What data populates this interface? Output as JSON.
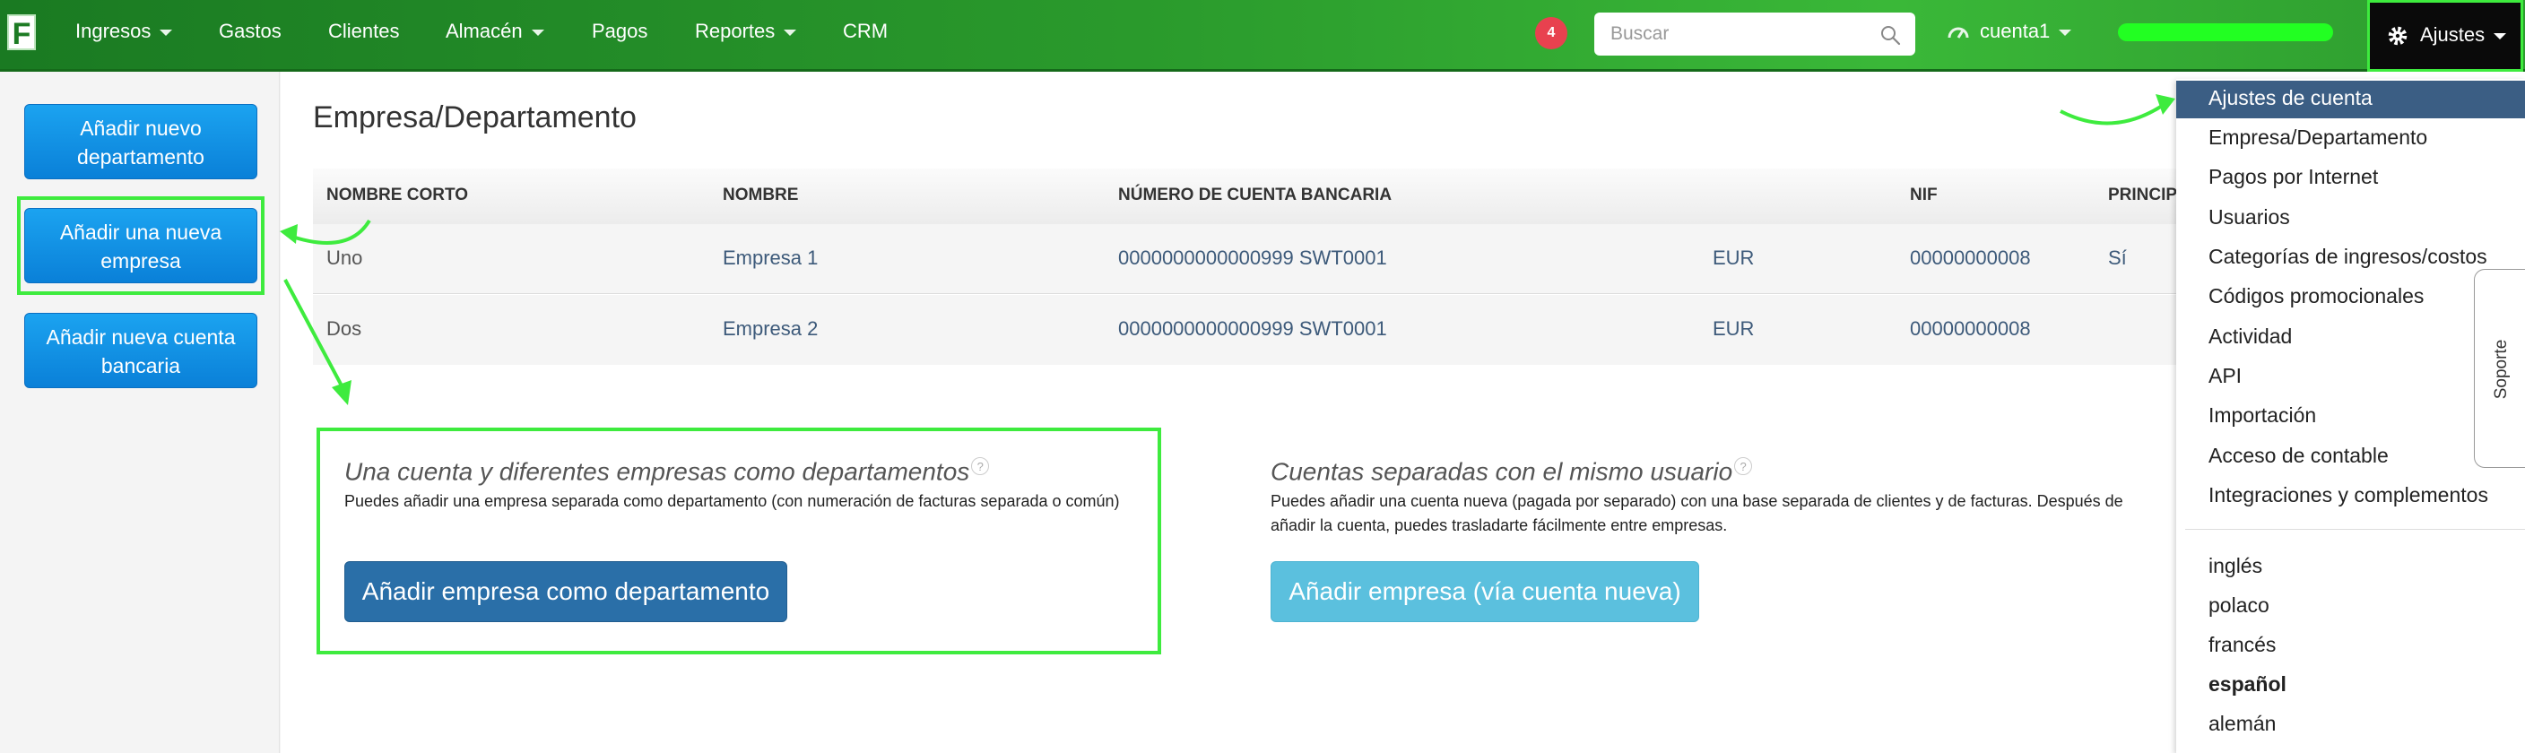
{
  "nav": {
    "logo": "F",
    "items": [
      {
        "label": "Ingresos",
        "caret": true
      },
      {
        "label": "Gastos",
        "caret": false
      },
      {
        "label": "Clientes",
        "caret": false
      },
      {
        "label": "Almacén",
        "caret": true
      },
      {
        "label": "Pagos",
        "caret": false
      },
      {
        "label": "Reportes",
        "caret": true
      },
      {
        "label": "CRM",
        "caret": false
      }
    ],
    "notifications": "4",
    "search_placeholder": "Buscar",
    "account": "cuenta1",
    "settings": "Ajustes"
  },
  "sidebar": {
    "buttons": [
      "Añadir nuevo departamento",
      "Añadir una nueva empresa",
      "Añadir nueva cuenta bancaria"
    ]
  },
  "main": {
    "title": "Empresa/Departamento",
    "table": {
      "headers": [
        "NOMBRE CORTO",
        "NOMBRE",
        "NÚMERO DE CUENTA BANCARIA",
        "NIF",
        "PRINCIP"
      ],
      "rows": [
        {
          "short": "Uno",
          "name": "Empresa 1",
          "account": "0000000000000999 SWT0001",
          "currency": "EUR",
          "nif": "00000000008",
          "principal": "Sí"
        },
        {
          "short": "Dos",
          "name": "Empresa 2",
          "account": "0000000000000999 SWT0001",
          "currency": "EUR",
          "nif": "00000000008",
          "principal": ""
        }
      ]
    },
    "option1": {
      "title": "Una cuenta y diferentes empresas como departamentos",
      "help": "?",
      "desc": "Puedes añadir una empresa separada como departamento (con numeración de facturas separada o común)",
      "button": "Añadir empresa como departamento"
    },
    "option2": {
      "title": "Cuentas separadas con el mismo usuario",
      "help": "?",
      "desc": "Puedes añadir una cuenta nueva (pagada por separado) con una base separada de clientes y de facturas. Después de añadir la cuenta, puedes trasladarte fácilmente entre empresas.",
      "button": "Añadir empresa (vía cuenta nueva)"
    }
  },
  "dropdown": {
    "items": [
      "Ajustes de cuenta",
      "Empresa/Departamento",
      "Pagos por Internet",
      "Usuarios",
      "Categorías de ingresos/costos",
      "Códigos promocionales",
      "Actividad",
      "API",
      "Importación",
      "Acceso de contable",
      "Integraciones y complementos"
    ],
    "languages": [
      "inglés",
      "polaco",
      "francés",
      "español",
      "alemán"
    ],
    "active_language": "español"
  },
  "support": "Soporte",
  "colors": {
    "highlight": "#3eeb3e",
    "nav_green": "#2a9a2c",
    "side_button": "#0a80d8",
    "dark_button": "#2a6fa8",
    "light_button": "#5bc0de",
    "active_item": "#3b5e84"
  }
}
